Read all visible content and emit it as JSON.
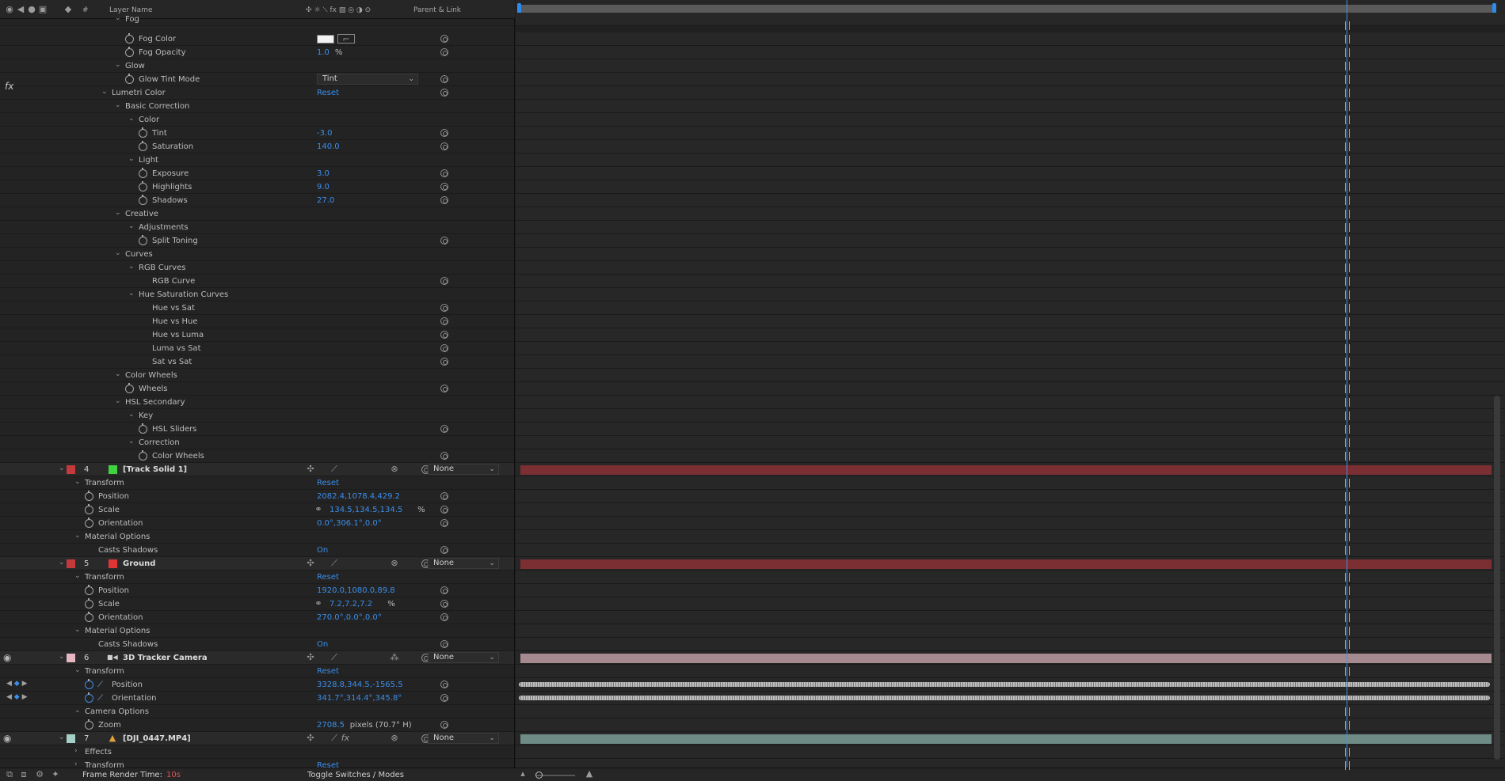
{
  "header": {
    "layer_name": "Layer Name",
    "parent_link": "Parent & Link"
  },
  "fx_marker": "fx",
  "rows": [
    {
      "kind": "group",
      "indent": 2,
      "label": "Fog",
      "partial": true
    },
    {
      "kind": "prop",
      "indent": 3,
      "label": "Fog Color",
      "swatch": true
    },
    {
      "kind": "prop",
      "indent": 3,
      "label": "Fog Opacity",
      "value": "1.0",
      "unit": "%"
    },
    {
      "kind": "group",
      "indent": 2,
      "label": "Glow"
    },
    {
      "kind": "prop",
      "indent": 3,
      "label": "Glow Tint Mode",
      "dropdown": "Tint"
    },
    {
      "kind": "effect",
      "indent": 1,
      "label": "Lumetri Color",
      "value": "Reset"
    },
    {
      "kind": "group",
      "indent": 2,
      "label": "Basic Correction"
    },
    {
      "kind": "group",
      "indent": 3,
      "label": "Color"
    },
    {
      "kind": "prop",
      "indent": 4,
      "label": "Tint",
      "value": "-3.0"
    },
    {
      "kind": "prop",
      "indent": 4,
      "label": "Saturation",
      "value": "140.0"
    },
    {
      "kind": "group",
      "indent": 3,
      "label": "Light"
    },
    {
      "kind": "prop",
      "indent": 4,
      "label": "Exposure",
      "value": "3.0"
    },
    {
      "kind": "prop",
      "indent": 4,
      "label": "Highlights",
      "value": "9.0"
    },
    {
      "kind": "prop",
      "indent": 4,
      "label": "Shadows",
      "value": "27.0"
    },
    {
      "kind": "group",
      "indent": 2,
      "label": "Creative"
    },
    {
      "kind": "group",
      "indent": 3,
      "label": "Adjustments"
    },
    {
      "kind": "prop",
      "indent": 4,
      "label": "Split Toning"
    },
    {
      "kind": "group",
      "indent": 2,
      "label": "Curves"
    },
    {
      "kind": "group",
      "indent": 3,
      "label": "RGB Curves"
    },
    {
      "kind": "leaf",
      "indent": 4,
      "label": "RGB Curve"
    },
    {
      "kind": "group",
      "indent": 3,
      "label": "Hue Saturation Curves"
    },
    {
      "kind": "leaf",
      "indent": 4,
      "label": "Hue vs Sat"
    },
    {
      "kind": "leaf",
      "indent": 4,
      "label": "Hue vs Hue"
    },
    {
      "kind": "leaf",
      "indent": 4,
      "label": "Hue vs Luma"
    },
    {
      "kind": "leaf",
      "indent": 4,
      "label": "Luma vs Sat"
    },
    {
      "kind": "leaf",
      "indent": 4,
      "label": "Sat vs Sat"
    },
    {
      "kind": "group",
      "indent": 2,
      "label": "Color Wheels"
    },
    {
      "kind": "prop",
      "indent": 3,
      "label": "Wheels"
    },
    {
      "kind": "group",
      "indent": 2,
      "label": "HSL Secondary"
    },
    {
      "kind": "group",
      "indent": 3,
      "label": "Key"
    },
    {
      "kind": "prop",
      "indent": 4,
      "label": "HSL Sliders"
    },
    {
      "kind": "group",
      "indent": 3,
      "label": "Correction"
    },
    {
      "kind": "prop",
      "indent": 4,
      "label": "Color Wheels"
    },
    {
      "kind": "layer",
      "num": "4",
      "label": "[Track Solid 1]",
      "label_color": "#c4393b",
      "icon_color": "#3fd43f",
      "bar": "#7b2f33",
      "parent": "None"
    },
    {
      "kind": "group",
      "indent": 0,
      "label": "Transform",
      "value": "Reset"
    },
    {
      "kind": "prop",
      "indent": 1,
      "label": "Position",
      "value": "2082.4,1078.4,429.2"
    },
    {
      "kind": "prop",
      "indent": 1,
      "label": "Scale",
      "value": "134.5,134.5,134.5",
      "unit": "%",
      "link": true
    },
    {
      "kind": "prop",
      "indent": 1,
      "label": "Orientation",
      "value": "0.0°,306.1°,0.0°"
    },
    {
      "kind": "group",
      "indent": 0,
      "label": "Material Options"
    },
    {
      "kind": "leaf",
      "indent": 1,
      "label": "Casts Shadows",
      "value": "On"
    },
    {
      "kind": "layer",
      "num": "5",
      "label": "Ground",
      "label_color": "#c4393b",
      "icon_color": "#e03535",
      "bar": "#7b2f33",
      "parent": "None"
    },
    {
      "kind": "group",
      "indent": 0,
      "label": "Transform",
      "value": "Reset"
    },
    {
      "kind": "prop",
      "indent": 1,
      "label": "Position",
      "value": "1920.0,1080.0,89.8"
    },
    {
      "kind": "prop",
      "indent": 1,
      "label": "Scale",
      "value": "7.2,7.2,7.2",
      "unit": "%",
      "link": true
    },
    {
      "kind": "prop",
      "indent": 1,
      "label": "Orientation",
      "value": "270.0°,0.0°,0.0°"
    },
    {
      "kind": "group",
      "indent": 0,
      "label": "Material Options"
    },
    {
      "kind": "leaf",
      "indent": 1,
      "label": "Casts Shadows",
      "value": "On"
    },
    {
      "kind": "layer",
      "num": "6",
      "label": "3D Tracker Camera",
      "label_color": "#e6b7c3",
      "icon": "camera",
      "bar": "#a58a90",
      "parent": "None",
      "eye": true
    },
    {
      "kind": "group",
      "indent": 0,
      "label": "Transform",
      "value": "Reset"
    },
    {
      "kind": "prop",
      "indent": 1,
      "label": "Position",
      "value": "3328.8,344.5,-1565.5",
      "animated": true
    },
    {
      "kind": "prop",
      "indent": 1,
      "label": "Orientation",
      "value": "341.7°,314.4°,345.8°",
      "animated": true
    },
    {
      "kind": "group",
      "indent": 0,
      "label": "Camera Options"
    },
    {
      "kind": "prop",
      "indent": 1,
      "label": "Zoom",
      "value": "2708.5",
      "unit": "pixels (70.7° H)"
    },
    {
      "kind": "layer",
      "num": "7",
      "label": "[DJI_0447.MP4]",
      "label_color": "#a4d0c8",
      "icon": "footage",
      "bar": "#6e8b85",
      "parent": "None",
      "eye": true,
      "fx": true
    },
    {
      "kind": "closed",
      "indent": 0,
      "label": "Effects"
    },
    {
      "kind": "closed",
      "indent": 0,
      "label": "Transform",
      "value": "Reset"
    }
  ],
  "footer": {
    "render_label": "Frame Render Time:",
    "render_value": "10s",
    "toggle": "Toggle Switches / Modes"
  }
}
